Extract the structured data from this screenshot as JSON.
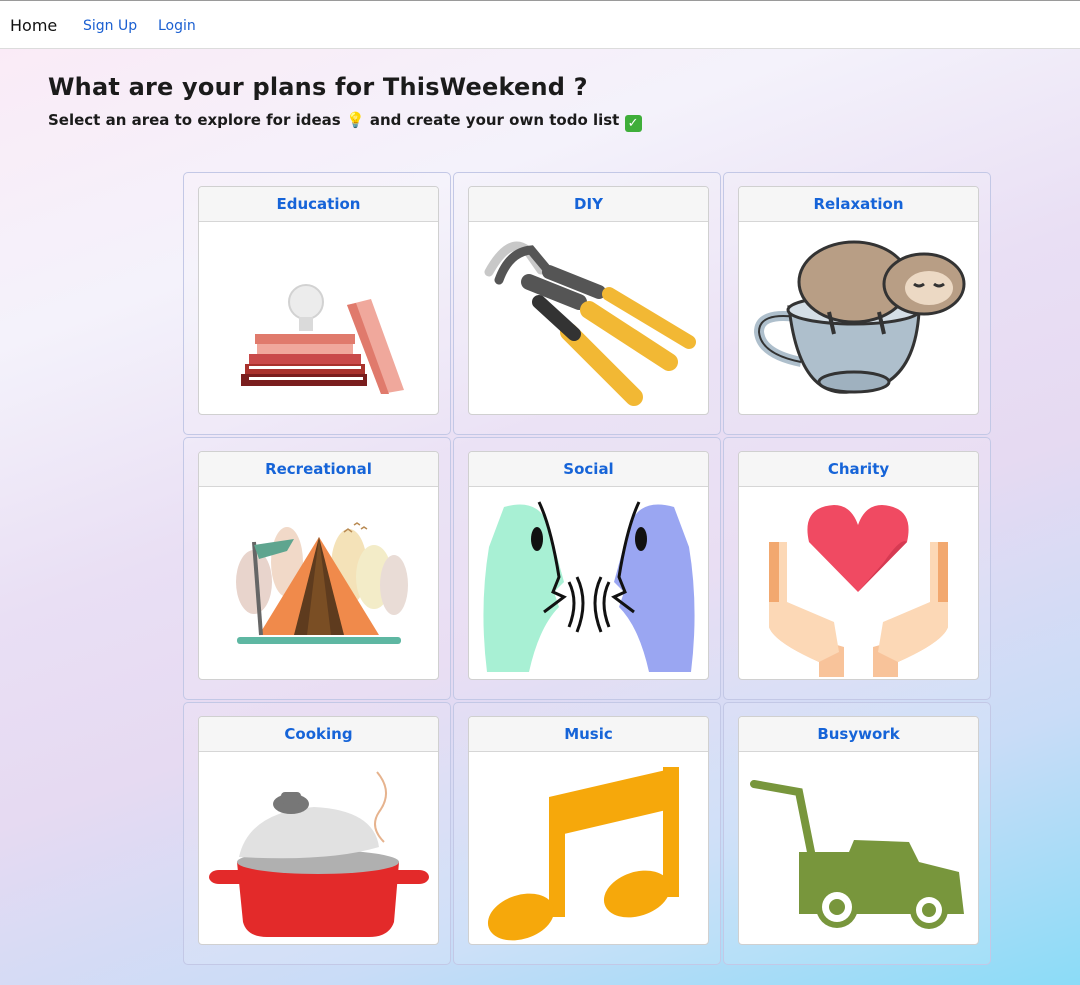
{
  "nav": {
    "home": "Home",
    "signup": "Sign Up",
    "login": "Login"
  },
  "page": {
    "title": "What are your plans for ThisWeekend ?",
    "subtitle_before": "Select an area to explore for ideas",
    "subtitle_middle": "and create your own todo list",
    "bulb_emoji": "💡",
    "check_emoji": "✓"
  },
  "categories": [
    {
      "label": "Education",
      "icon": "books-lightbulb-icon"
    },
    {
      "label": "DIY",
      "icon": "pincers-icon"
    },
    {
      "label": "Relaxation",
      "icon": "sloth-teacup-icon"
    },
    {
      "label": "Recreational",
      "icon": "tent-camping-icon"
    },
    {
      "label": "Social",
      "icon": "faces-talking-icon"
    },
    {
      "label": "Charity",
      "icon": "heart-hands-icon"
    },
    {
      "label": "Cooking",
      "icon": "cooking-pot-icon"
    },
    {
      "label": "Music",
      "icon": "music-note-icon"
    },
    {
      "label": "Busywork",
      "icon": "lawn-mower-icon"
    }
  ],
  "colors": {
    "link": "#1664d8",
    "card_border": "#c3c8e6"
  }
}
